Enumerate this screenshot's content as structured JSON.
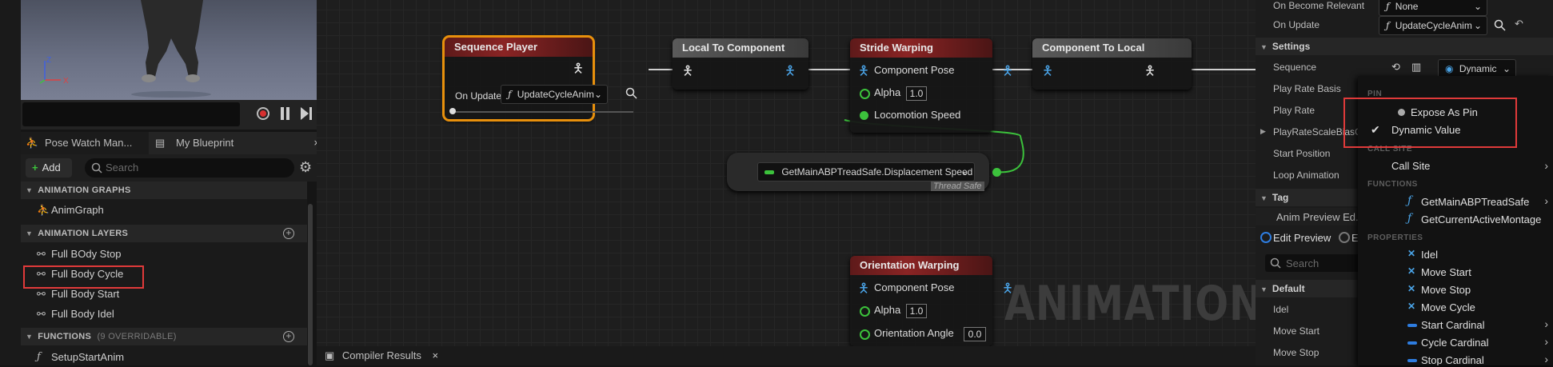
{
  "left_panel": {
    "tabs": [
      "Pose Watch Man...",
      "My Blueprint"
    ],
    "tab_close": "×",
    "add_label": "Add",
    "search_placeholder": "Search",
    "sections": {
      "animation_graphs": "ANIMATION GRAPHS",
      "animation_layers": "ANIMATION LAYERS",
      "functions": "FUNCTIONS",
      "functions_note": "(9 OVERRIDABLE)"
    },
    "graphs": [
      "AnimGraph"
    ],
    "layers": [
      "Full BOdy Stop",
      "Full Body Cycle",
      "Full Body Start",
      "Full Body Idel"
    ],
    "functions": [
      "SetupStartAnim"
    ],
    "highlighted_item": "Full Body Cycle"
  },
  "graph": {
    "nodes": {
      "sequence_player": {
        "title": "Sequence Player",
        "on_update_label": "On Update",
        "on_update_value": "UpdateCycleAnim"
      },
      "local_to_component": {
        "title": "Local To Component"
      },
      "stride_warping": {
        "title": "Stride Warping",
        "pin_pose": "Component Pose",
        "pin_alpha": "Alpha",
        "alpha_value": "1.0",
        "pin_speed": "Locomotion Speed"
      },
      "component_to_local": {
        "title": "Component To Local"
      },
      "getter": {
        "label": "GetMainABPTreadSafe.Displacement Speed",
        "badge": "Thread Safe"
      },
      "orientation_warping": {
        "title": "Orientation Warping",
        "pin_pose": "Component Pose",
        "pin_alpha": "Alpha",
        "alpha_value": "1.0",
        "pin_angle": "Orientation Angle",
        "angle_value": "0.0"
      }
    },
    "watermark": "ANIMATION",
    "compiler_tab": "Compiler Results",
    "compiler_close": "×"
  },
  "details": {
    "on_become_relevant_label": "On Become Relevant",
    "on_become_relevant_value": "None",
    "on_update_label": "On Update",
    "on_update_value": "UpdateCycleAnim",
    "settings_header": "Settings",
    "rows": [
      "Sequence",
      "Play Rate Basis",
      "Play Rate",
      "PlayRateScaleBiasCl",
      "Start Position",
      "Loop Animation"
    ],
    "sequence_mode": "Dynamic",
    "tag_header": "Tag",
    "preview_title": "Anim Preview Ed...",
    "edit_preview": "Edit Preview",
    "edit_preview_other": "E",
    "search_placeholder": "Search",
    "default_header": "Default",
    "default_rows": [
      "Idel",
      "Move Start",
      "Move Stop"
    ]
  },
  "dropdown": {
    "pin_header": "PIN",
    "expose_as_pin": "Expose As Pin",
    "dynamic_value": "Dynamic Value",
    "call_site_header": "CALL SITE",
    "call_site": "Call Site",
    "functions_header": "FUNCTIONS",
    "functions": [
      "GetMainABPTreadSafe",
      "GetCurrentActiveMontage"
    ],
    "properties_header": "PROPERTIES",
    "properties": [
      "Idel",
      "Move Start",
      "Move Stop",
      "Move Cycle",
      "Start Cardinal",
      "Cycle Cardinal",
      "Stop Cardinal"
    ]
  },
  "colors": {
    "highlight": "#e03a3a",
    "selected_node": "#e8900c",
    "pin_green": "#3cc23c",
    "accent_blue": "#4aa3e6"
  }
}
